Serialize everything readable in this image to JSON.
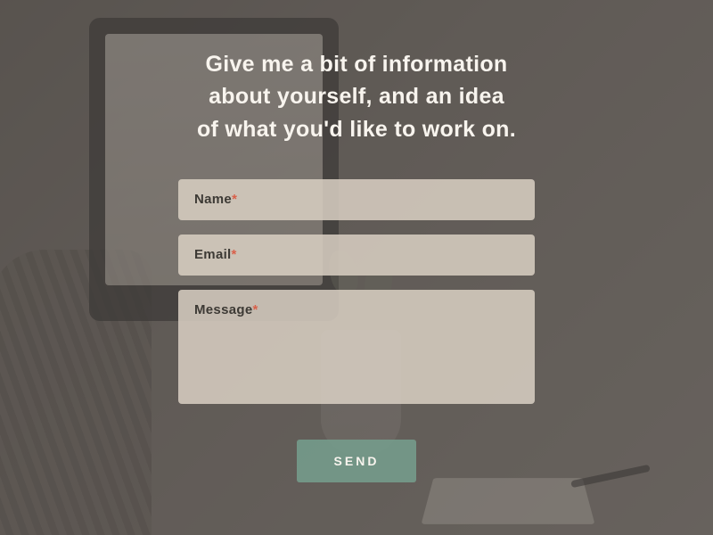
{
  "heading": {
    "line1": "Give me a bit of information",
    "line2": "about yourself, and an idea",
    "line3": "of what you'd like to work on."
  },
  "form": {
    "name": {
      "label": "Name",
      "required_marker": "*",
      "value": ""
    },
    "email": {
      "label": "Email",
      "required_marker": "*",
      "value": ""
    },
    "message": {
      "label": "Message",
      "required_marker": "*",
      "value": ""
    },
    "submit_label": "SEND"
  },
  "colors": {
    "heading_text": "#f8f4ee",
    "field_bg": "rgba(214, 205, 192, 0.88)",
    "label_text": "#3d3a35",
    "required": "#d9604a",
    "button_bg": "rgba(118, 160, 142, 0.85)",
    "button_text": "#f8f4ee",
    "overlay": "rgba(75, 70, 65, 0.55)"
  }
}
